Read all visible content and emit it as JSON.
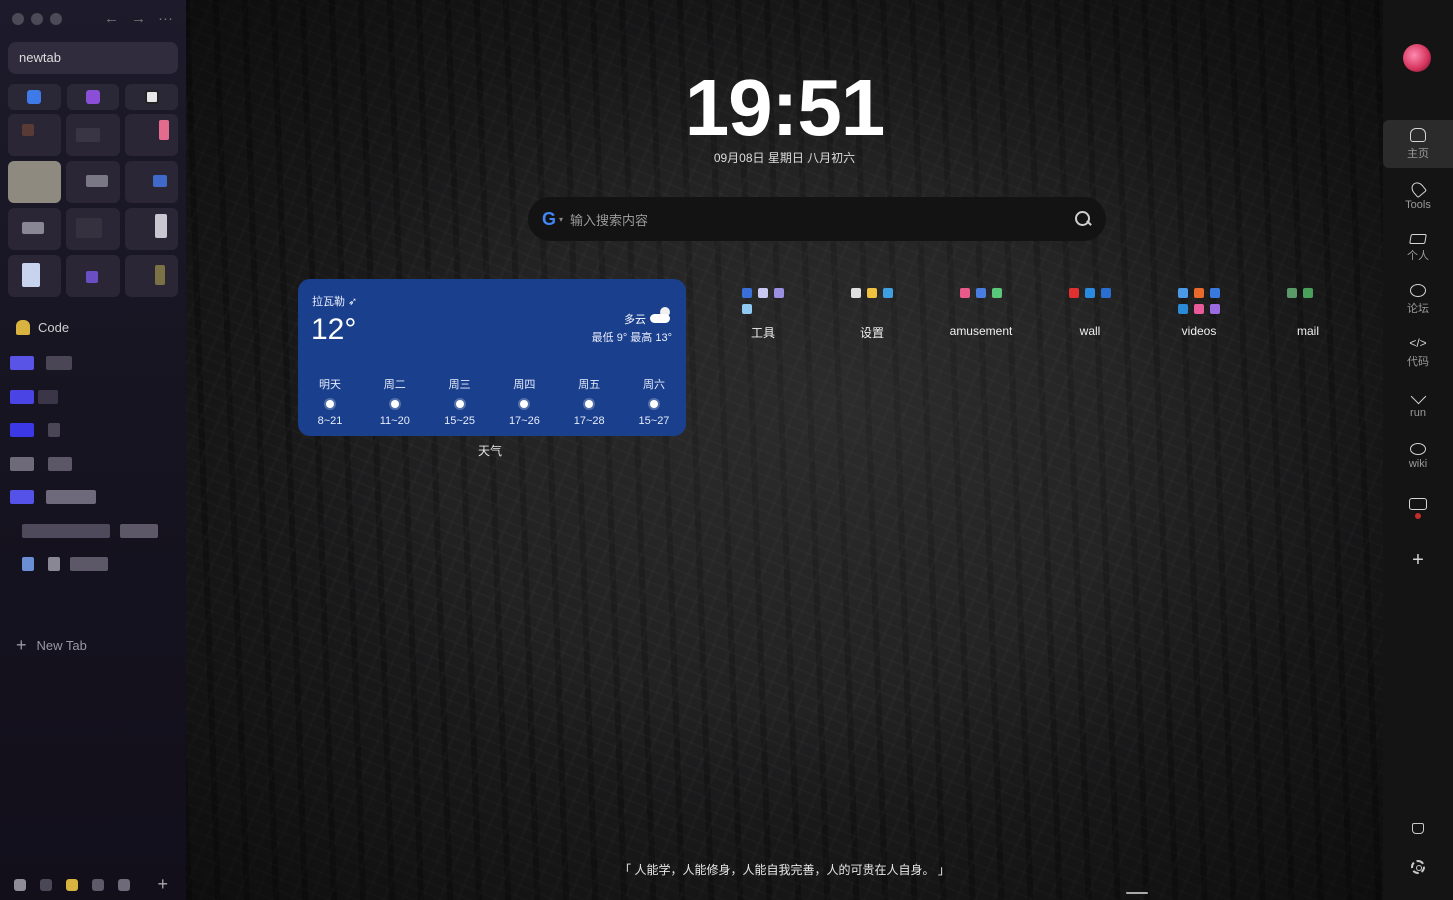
{
  "sidebar": {
    "address": "newtab",
    "folder_label": "Code",
    "new_tab_label": "New Tab",
    "add_glyph": "+",
    "add_glyph_bottom": "+"
  },
  "main": {
    "time": "19:51",
    "date": "09月08日 星期日 八月初六",
    "search_placeholder": "输入搜索内容",
    "search_engine_letter": "G",
    "search_engine_caret": "▾",
    "weather": {
      "location": "拉瓦勒 ➶",
      "temperature": "12°",
      "condition": "多云",
      "range": "最低 9° 最高 13°",
      "caption": "天气",
      "forecast": [
        {
          "day": "明天",
          "range": "8~21"
        },
        {
          "day": "周二",
          "range": "11~20"
        },
        {
          "day": "周三",
          "range": "15~25"
        },
        {
          "day": "周四",
          "range": "17~26"
        },
        {
          "day": "周五",
          "range": "17~28"
        },
        {
          "day": "周六",
          "range": "15~27"
        }
      ]
    },
    "groups": [
      "工具",
      "设置",
      "amusement",
      "wall",
      "videos",
      "mail"
    ],
    "quote": "「 人能学，人能修身，人能自我完善，人的可贵在人自身。 」"
  },
  "rail": {
    "items": [
      {
        "label": "主页"
      },
      {
        "label": "Tools"
      },
      {
        "label": "个人"
      },
      {
        "label": "论坛"
      },
      {
        "label": "代码",
        "icon_text": "</>"
      },
      {
        "label": "run"
      },
      {
        "label": "wiki"
      }
    ],
    "plus": "+"
  },
  "colors": {
    "weather_card": "#1a3f8c",
    "sidebar_bg": "#1d1a2b",
    "accent_red": "#c82d2d"
  }
}
